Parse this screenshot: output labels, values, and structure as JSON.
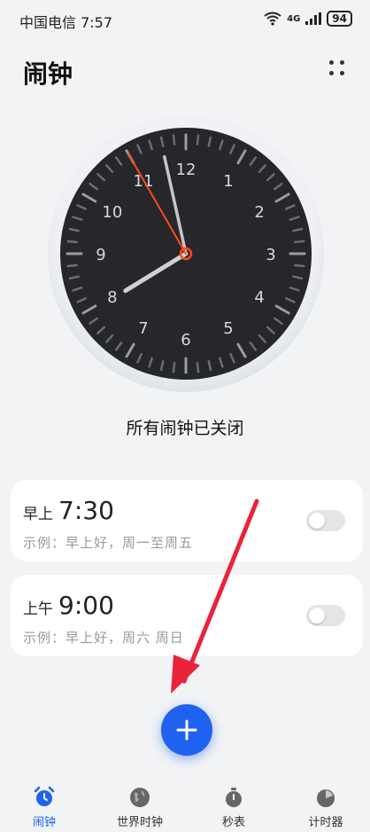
{
  "status_bar": {
    "carrier_time": "中国电信 7:57",
    "network": "4G",
    "battery": "94"
  },
  "header": {
    "title": "闹钟"
  },
  "clock": {
    "numbers": [
      "12",
      "1",
      "2",
      "3",
      "4",
      "5",
      "6",
      "7",
      "8",
      "9",
      "10",
      "11"
    ],
    "time_shown": {
      "hour": 7,
      "minute": 57,
      "second": 55
    }
  },
  "status_message": "所有闹钟已关闭",
  "alarms": [
    {
      "period": "早上",
      "time": "7:30",
      "description": "示例：早上好，周一至周五",
      "enabled": false
    },
    {
      "period": "上午",
      "time": "9:00",
      "description": "示例：早上好，周六 周日",
      "enabled": false
    }
  ],
  "bottom_nav": {
    "items": [
      {
        "label": "闹钟",
        "icon": "alarm-clock-icon",
        "active": true
      },
      {
        "label": "世界时钟",
        "icon": "globe-icon",
        "active": false
      },
      {
        "label": "秒表",
        "icon": "stopwatch-icon",
        "active": false
      },
      {
        "label": "计时器",
        "icon": "timer-icon",
        "active": false
      }
    ]
  },
  "colors": {
    "accent": "#1f62ef",
    "second_hand": "#ff4a1c",
    "clock_face": "#26272b",
    "annotation_arrow": "#e8233a"
  }
}
